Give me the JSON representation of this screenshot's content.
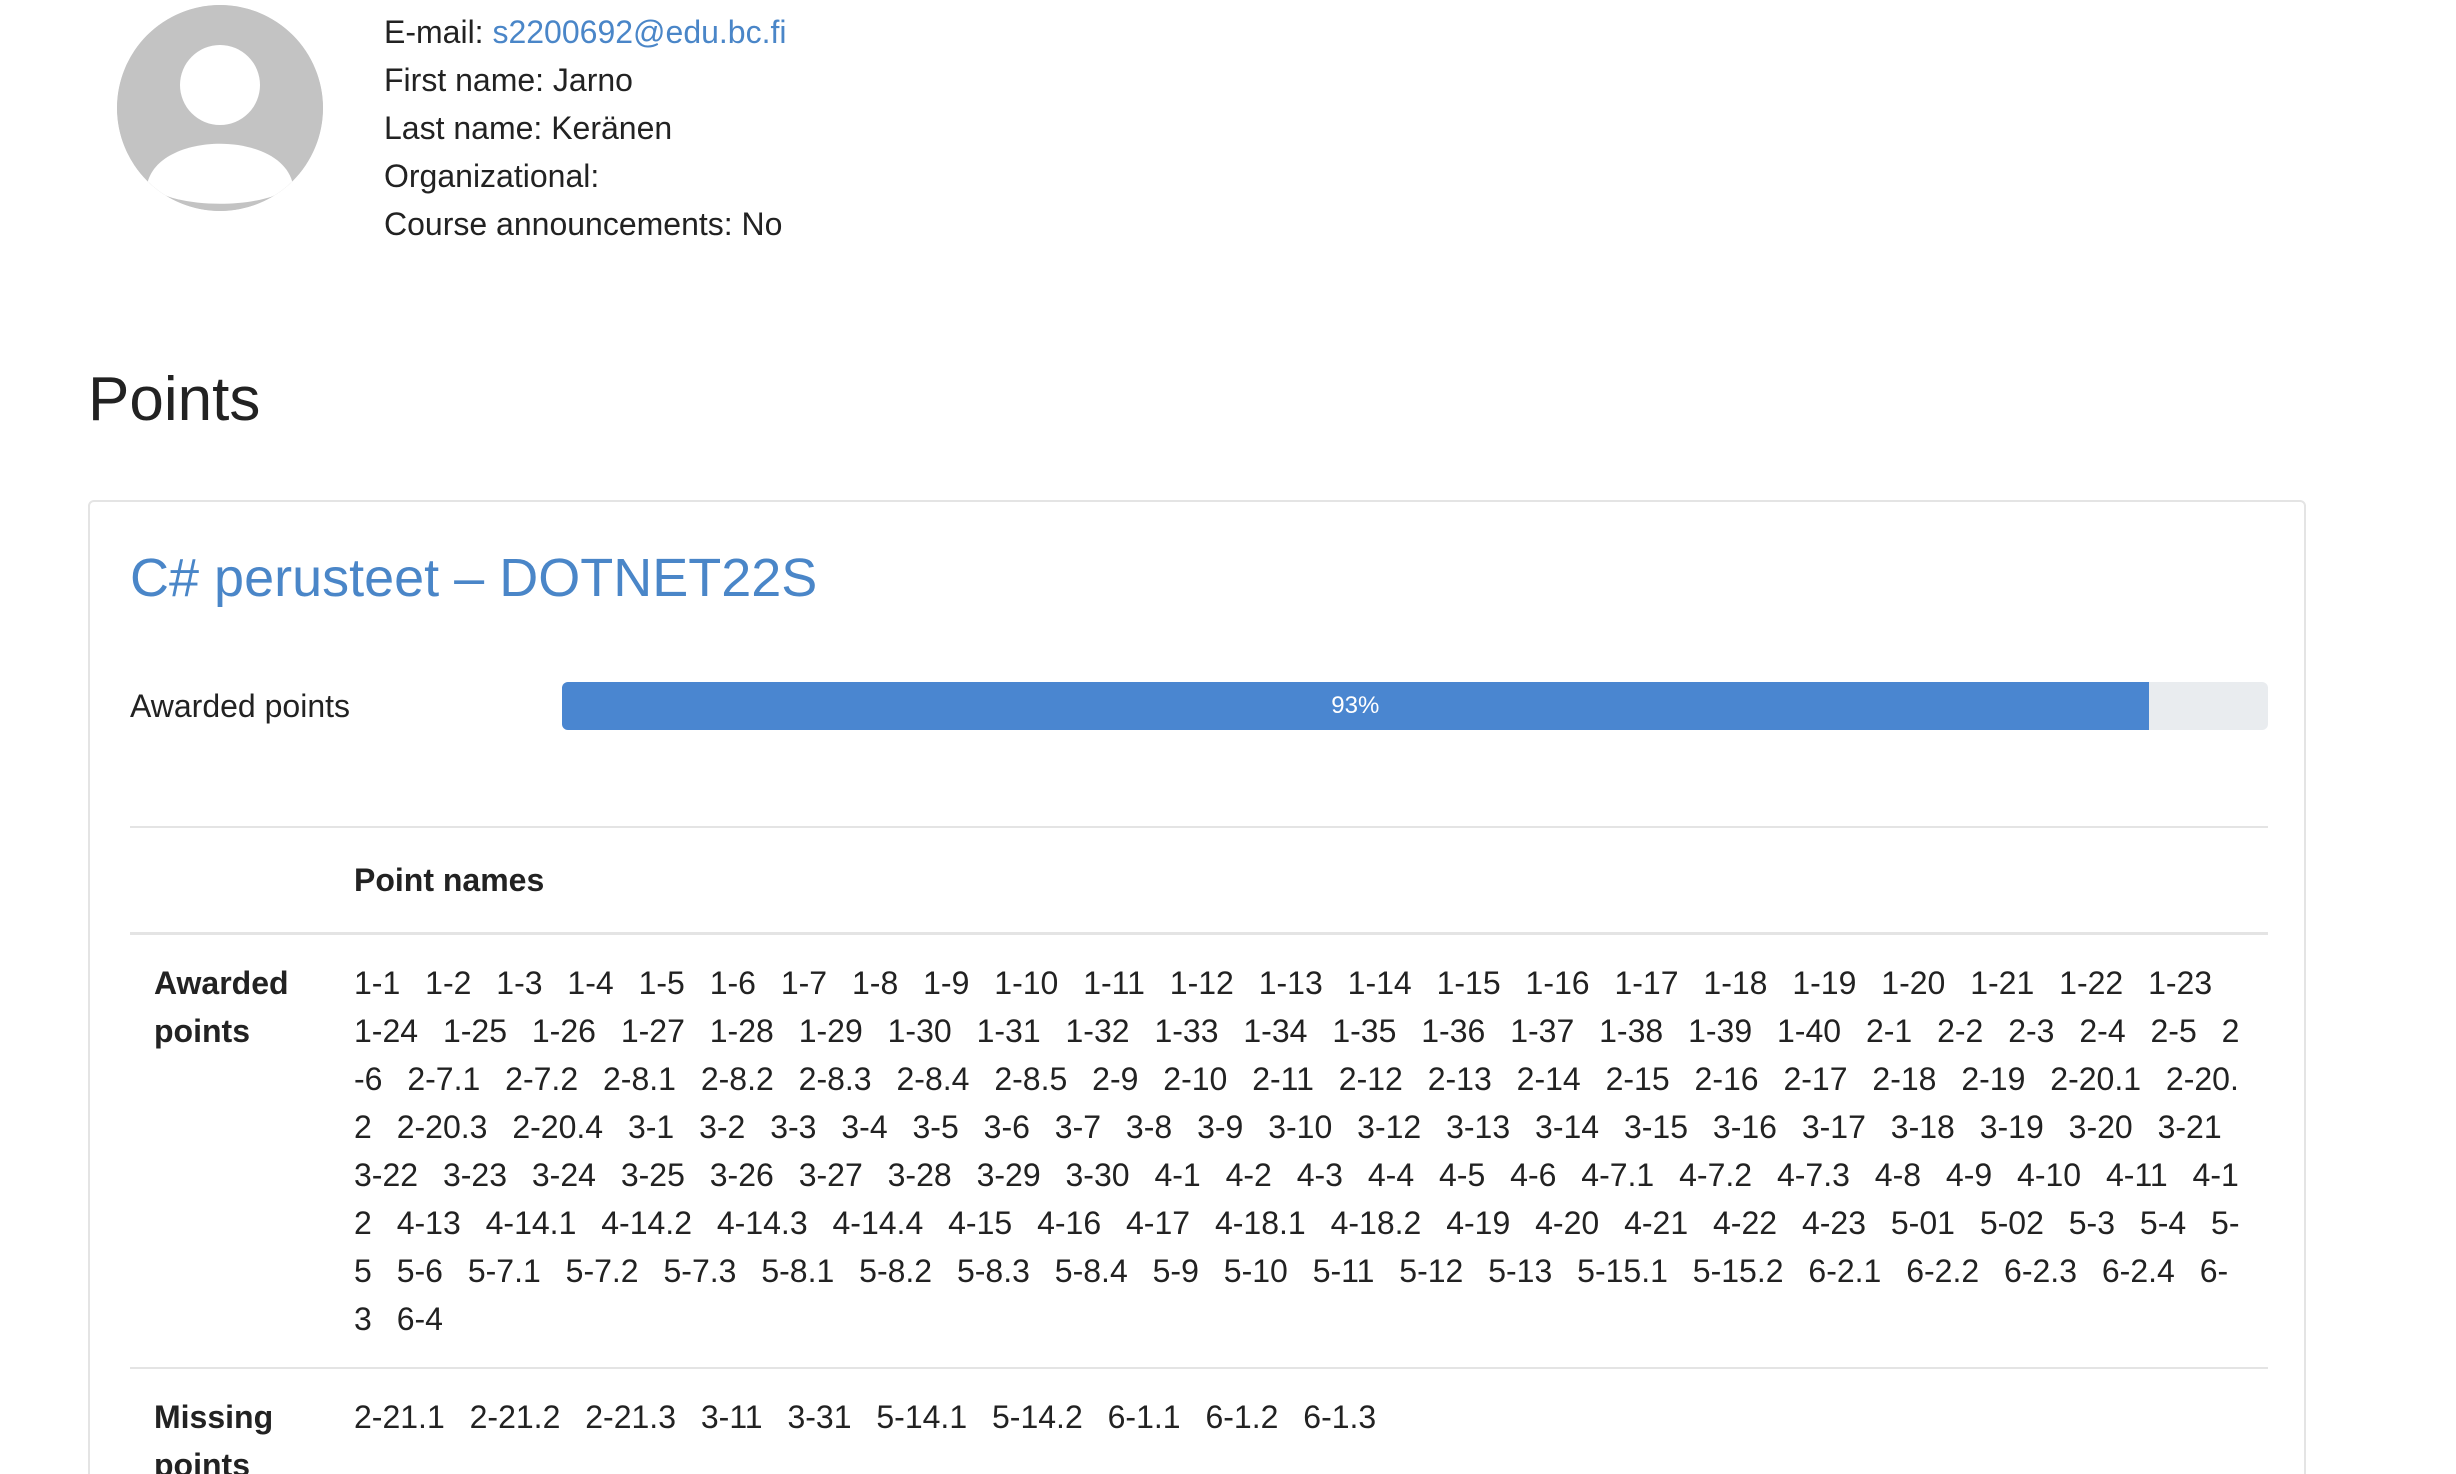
{
  "profile": {
    "email_label": "E-mail: ",
    "email": "s2200692@edu.bc.fi",
    "first_name": "First name: Jarno",
    "last_name": "Last name: Keränen",
    "organizational": "Organizational:",
    "course_announcements": "Course announcements: No",
    "avatar_icon": "user-avatar-icon"
  },
  "points": {
    "title": "Points"
  },
  "course": {
    "title": "C# perusteet – DOTNET22S",
    "awarded_label": "Awarded points",
    "progress_text": "93%",
    "progress_value": 93,
    "colors": {
      "link": "#4a86c8",
      "progress": "#4a86d0",
      "track": "#e9ecef"
    }
  },
  "table": {
    "header_blank": "",
    "header_names": "Point names",
    "awarded_label": "Awarded points",
    "missing_label": "Missing points",
    "awarded": [
      "1-1",
      "1-2",
      "1-3",
      "1-4",
      "1-5",
      "1-6",
      "1-7",
      "1-8",
      "1-9",
      "1-10",
      "1-11",
      "1-12",
      "1-13",
      "1-14",
      "1-15",
      "1-16",
      "1-17",
      "1-18",
      "1-19",
      "1-20",
      "1-21",
      "1-22",
      "1-23",
      "1-24",
      "1-25",
      "1-26",
      "1-27",
      "1-28",
      "1-29",
      "1-30",
      "1-31",
      "1-32",
      "1-33",
      "1-34",
      "1-35",
      "1-36",
      "1-37",
      "1-38",
      "1-39",
      "1-40",
      "2-1",
      "2-2",
      "2-3",
      "2-4",
      "2-5",
      "2-6",
      "2-7.1",
      "2-7.2",
      "2-8.1",
      "2-8.2",
      "2-8.3",
      "2-8.4",
      "2-8.5",
      "2-9",
      "2-10",
      "2-11",
      "2-12",
      "2-13",
      "2-14",
      "2-15",
      "2-16",
      "2-17",
      "2-18",
      "2-19",
      "2-20.1",
      "2-20.2",
      "2-20.3",
      "2-20.4",
      "3-1",
      "3-2",
      "3-3",
      "3-4",
      "3-5",
      "3-6",
      "3-7",
      "3-8",
      "3-9",
      "3-10",
      "3-12",
      "3-13",
      "3-14",
      "3-15",
      "3-16",
      "3-17",
      "3-18",
      "3-19",
      "3-20",
      "3-21",
      "3-22",
      "3-23",
      "3-24",
      "3-25",
      "3-26",
      "3-27",
      "3-28",
      "3-29",
      "3-30",
      "4-1",
      "4-2",
      "4-3",
      "4-4",
      "4-5",
      "4-6",
      "4-7.1",
      "4-7.2",
      "4-7.3",
      "4-8",
      "4-9",
      "4-10",
      "4-11",
      "4-12",
      "4-13",
      "4-14.1",
      "4-14.2",
      "4-14.3",
      "4-14.4",
      "4-15",
      "4-16",
      "4-17",
      "4-18.1",
      "4-18.2",
      "4-19",
      "4-20",
      "4-21",
      "4-22",
      "4-23",
      "5-01",
      "5-02",
      "5-3",
      "5-4",
      "5-5",
      "5-6",
      "5-7.1",
      "5-7.2",
      "5-7.3",
      "5-8.1",
      "5-8.2",
      "5-8.3",
      "5-8.4",
      "5-9",
      "5-10",
      "5-11",
      "5-12",
      "5-13",
      "5-15.1",
      "5-15.2",
      "6-2.1",
      "6-2.2",
      "6-2.3",
      "6-2.4",
      "6-3",
      "6-4"
    ],
    "missing": [
      "2-21.1",
      "2-21.2",
      "2-21.3",
      "3-11",
      "3-31",
      "5-14.1",
      "5-14.2",
      "6-1.1",
      "6-1.2",
      "6-1.3"
    ]
  }
}
